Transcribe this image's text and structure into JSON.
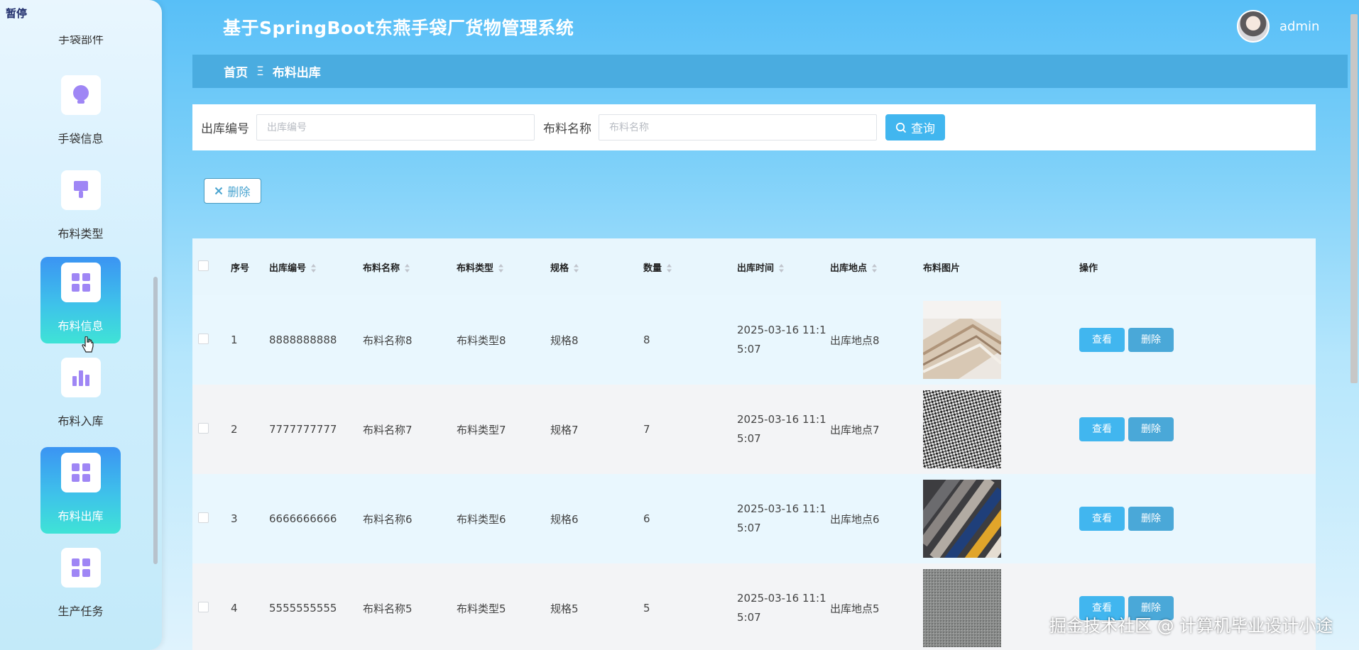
{
  "pause_tag": "暂停",
  "header": {
    "title": "基于SpringBoot东燕手袋厂货物管理系统",
    "username": "admin"
  },
  "sidebar": {
    "partial_item": "手袋部件",
    "items": [
      {
        "label": "手袋信息",
        "icon": "lightbulb-icon",
        "active": false
      },
      {
        "label": "布料类型",
        "icon": "brush-icon",
        "active": false
      },
      {
        "label": "布料信息",
        "icon": "grid-icon",
        "active": true
      },
      {
        "label": "布料入库",
        "icon": "bar-chart-icon",
        "active": false
      },
      {
        "label": "布料出库",
        "icon": "grid-icon",
        "active": true
      },
      {
        "label": "生产任务",
        "icon": "grid-icon",
        "active": false
      }
    ]
  },
  "breadcrumb": {
    "home": "首页",
    "separator": "Ξ",
    "current": "布料出库"
  },
  "search": {
    "field1_label": "出库编号",
    "field1_placeholder": "出库编号",
    "field2_label": "布料名称",
    "field2_placeholder": "布料名称",
    "button_label": "查询"
  },
  "toolbar": {
    "delete_label": "删除"
  },
  "table": {
    "columns": [
      "序号",
      "出库编号",
      "布料名称",
      "布料类型",
      "规格",
      "数量",
      "出库时间",
      "出库地点",
      "布料图片",
      "操作"
    ],
    "rows": [
      {
        "index": "1",
        "code": "8888888888",
        "name": "布料名称8",
        "type": "布料类型8",
        "spec": "规格8",
        "qty": "8",
        "time_a": "2025-03-16 11:1",
        "time_b": "5:07",
        "place": "出库地点8"
      },
      {
        "index": "2",
        "code": "7777777777",
        "name": "布料名称7",
        "type": "布料类型7",
        "spec": "规格7",
        "qty": "7",
        "time_a": "2025-03-16 11:1",
        "time_b": "5:07",
        "place": "出库地点7"
      },
      {
        "index": "3",
        "code": "6666666666",
        "name": "布料名称6",
        "type": "布料类型6",
        "spec": "规格6",
        "qty": "6",
        "time_a": "2025-03-16 11:1",
        "time_b": "5:07",
        "place": "出库地点6"
      },
      {
        "index": "4",
        "code": "5555555555",
        "name": "布料名称5",
        "type": "布料类型5",
        "spec": "规格5",
        "qty": "5",
        "time_a": "2025-03-16 11:1",
        "time_b": "5:07",
        "place": "出库地点5"
      }
    ],
    "view_label": "查看",
    "delete_label": "删除"
  },
  "watermark": "掘金技术社区 @ 计算机毕业设计小途",
  "colors": {
    "primary": "#41b6ef",
    "breadcrumb_bg": "#4aace0",
    "active_item_top": "#3b94f3",
    "active_item_bottom": "#3fe3d6"
  }
}
